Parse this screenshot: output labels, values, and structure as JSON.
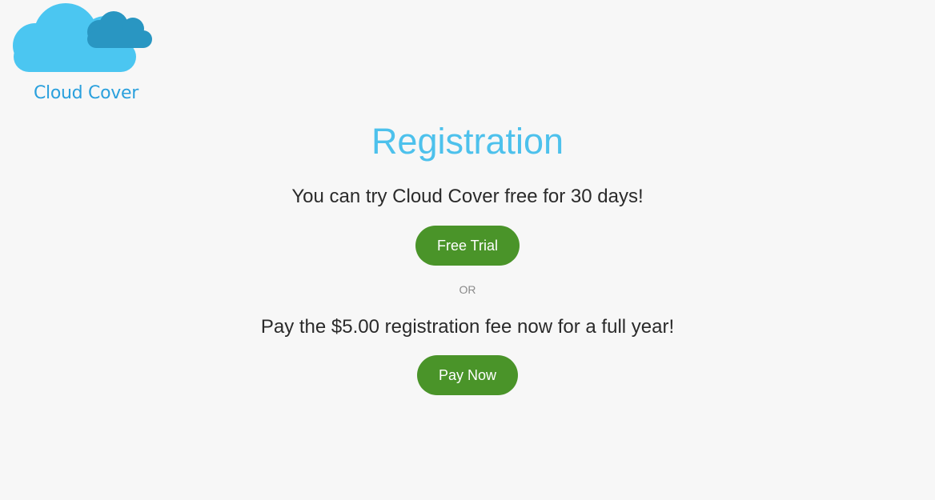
{
  "brand": {
    "name": "Cloud Cover",
    "logo_icon": "cloud-icon",
    "colors": {
      "primary_cloud": "#4bc6f1",
      "secondary_cloud": "#2996c2",
      "text": "#2aa0dd"
    }
  },
  "main": {
    "title": "Registration",
    "trial_text": "You can try Cloud Cover free for 30 days!",
    "trial_button": "Free Trial",
    "separator": "OR",
    "pay_text": "Pay the $5.00 registration fee now for a full year!",
    "pay_button": "Pay Now"
  },
  "colors": {
    "background": "#f7f7f7",
    "title": "#4dc1ec",
    "button": "#4a9429",
    "button_text": "#ffffff"
  }
}
